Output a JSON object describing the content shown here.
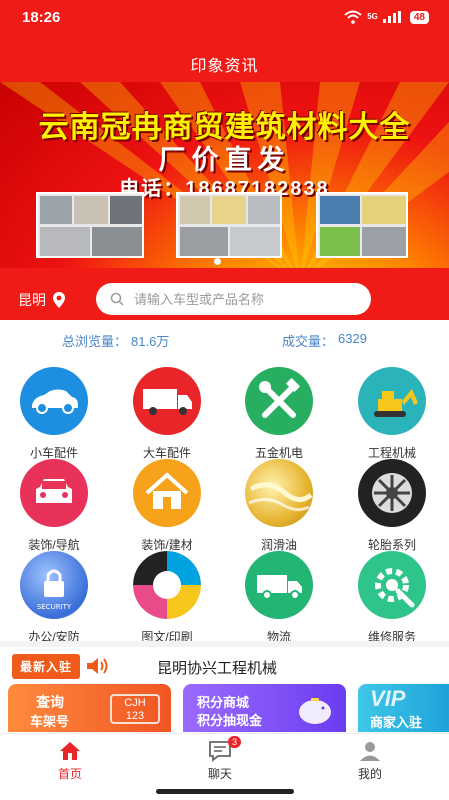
{
  "status": {
    "time": "18:26",
    "network": "5G",
    "battery": "48"
  },
  "header": {
    "title": "印象资讯"
  },
  "banner": {
    "line1": "云南冠冉商贸建筑材料大全",
    "line2": "厂价直发",
    "line3": "电话：18687182838"
  },
  "location": {
    "city": "昆明"
  },
  "search": {
    "placeholder": "请输入车型或产品名称"
  },
  "stats": {
    "views_label": "总浏览量：",
    "views_value": "81.6万",
    "deals_label": "成交量：",
    "deals_value": "6329"
  },
  "categories": [
    {
      "label": "小车配件",
      "icon": "car-icon",
      "color": "#1e8fe0"
    },
    {
      "label": "大车配件",
      "icon": "truck-icon",
      "color": "#e8262a"
    },
    {
      "label": "五金机电",
      "icon": "tools-icon",
      "color": "#27ae60"
    },
    {
      "label": "工程机械",
      "icon": "excavator-icon",
      "color": "#2ab3b8"
    },
    {
      "label": "装饰/导航",
      "icon": "car-front-icon",
      "color": "#e8325a"
    },
    {
      "label": "装饰/建材",
      "icon": "house-icon",
      "color": "#f7a21b"
    },
    {
      "label": "润滑油",
      "icon": "oil-icon",
      "color": "#e7b530"
    },
    {
      "label": "轮胎系列",
      "icon": "tire-icon",
      "color": "#222222"
    },
    {
      "label": "办公/安防",
      "icon": "security-icon",
      "color": "#3a6fd8"
    },
    {
      "label": "图文/印刷",
      "icon": "print-icon",
      "color": "#e94b8a"
    },
    {
      "label": "物流",
      "icon": "delivery-truck-icon",
      "color": "#22b573"
    },
    {
      "label": "维修服务",
      "icon": "gear-wrench-icon",
      "color": "#2ec48a"
    }
  ],
  "news": {
    "badge": "最新入驻",
    "text": "昆明协兴工程机械"
  },
  "promos": [
    {
      "title": "查询",
      "subtitle": "车架号",
      "tag": "CJH",
      "tag2": "123"
    },
    {
      "title": "积分商城",
      "subtitle": "积分抽现金"
    },
    {
      "title": "VIP",
      "subtitle": "商家入驻"
    }
  ],
  "tabs": [
    {
      "label": "首页",
      "active": true,
      "color": "#e8262a"
    },
    {
      "label": "聊天",
      "badge": "3"
    },
    {
      "label": "我的"
    }
  ]
}
